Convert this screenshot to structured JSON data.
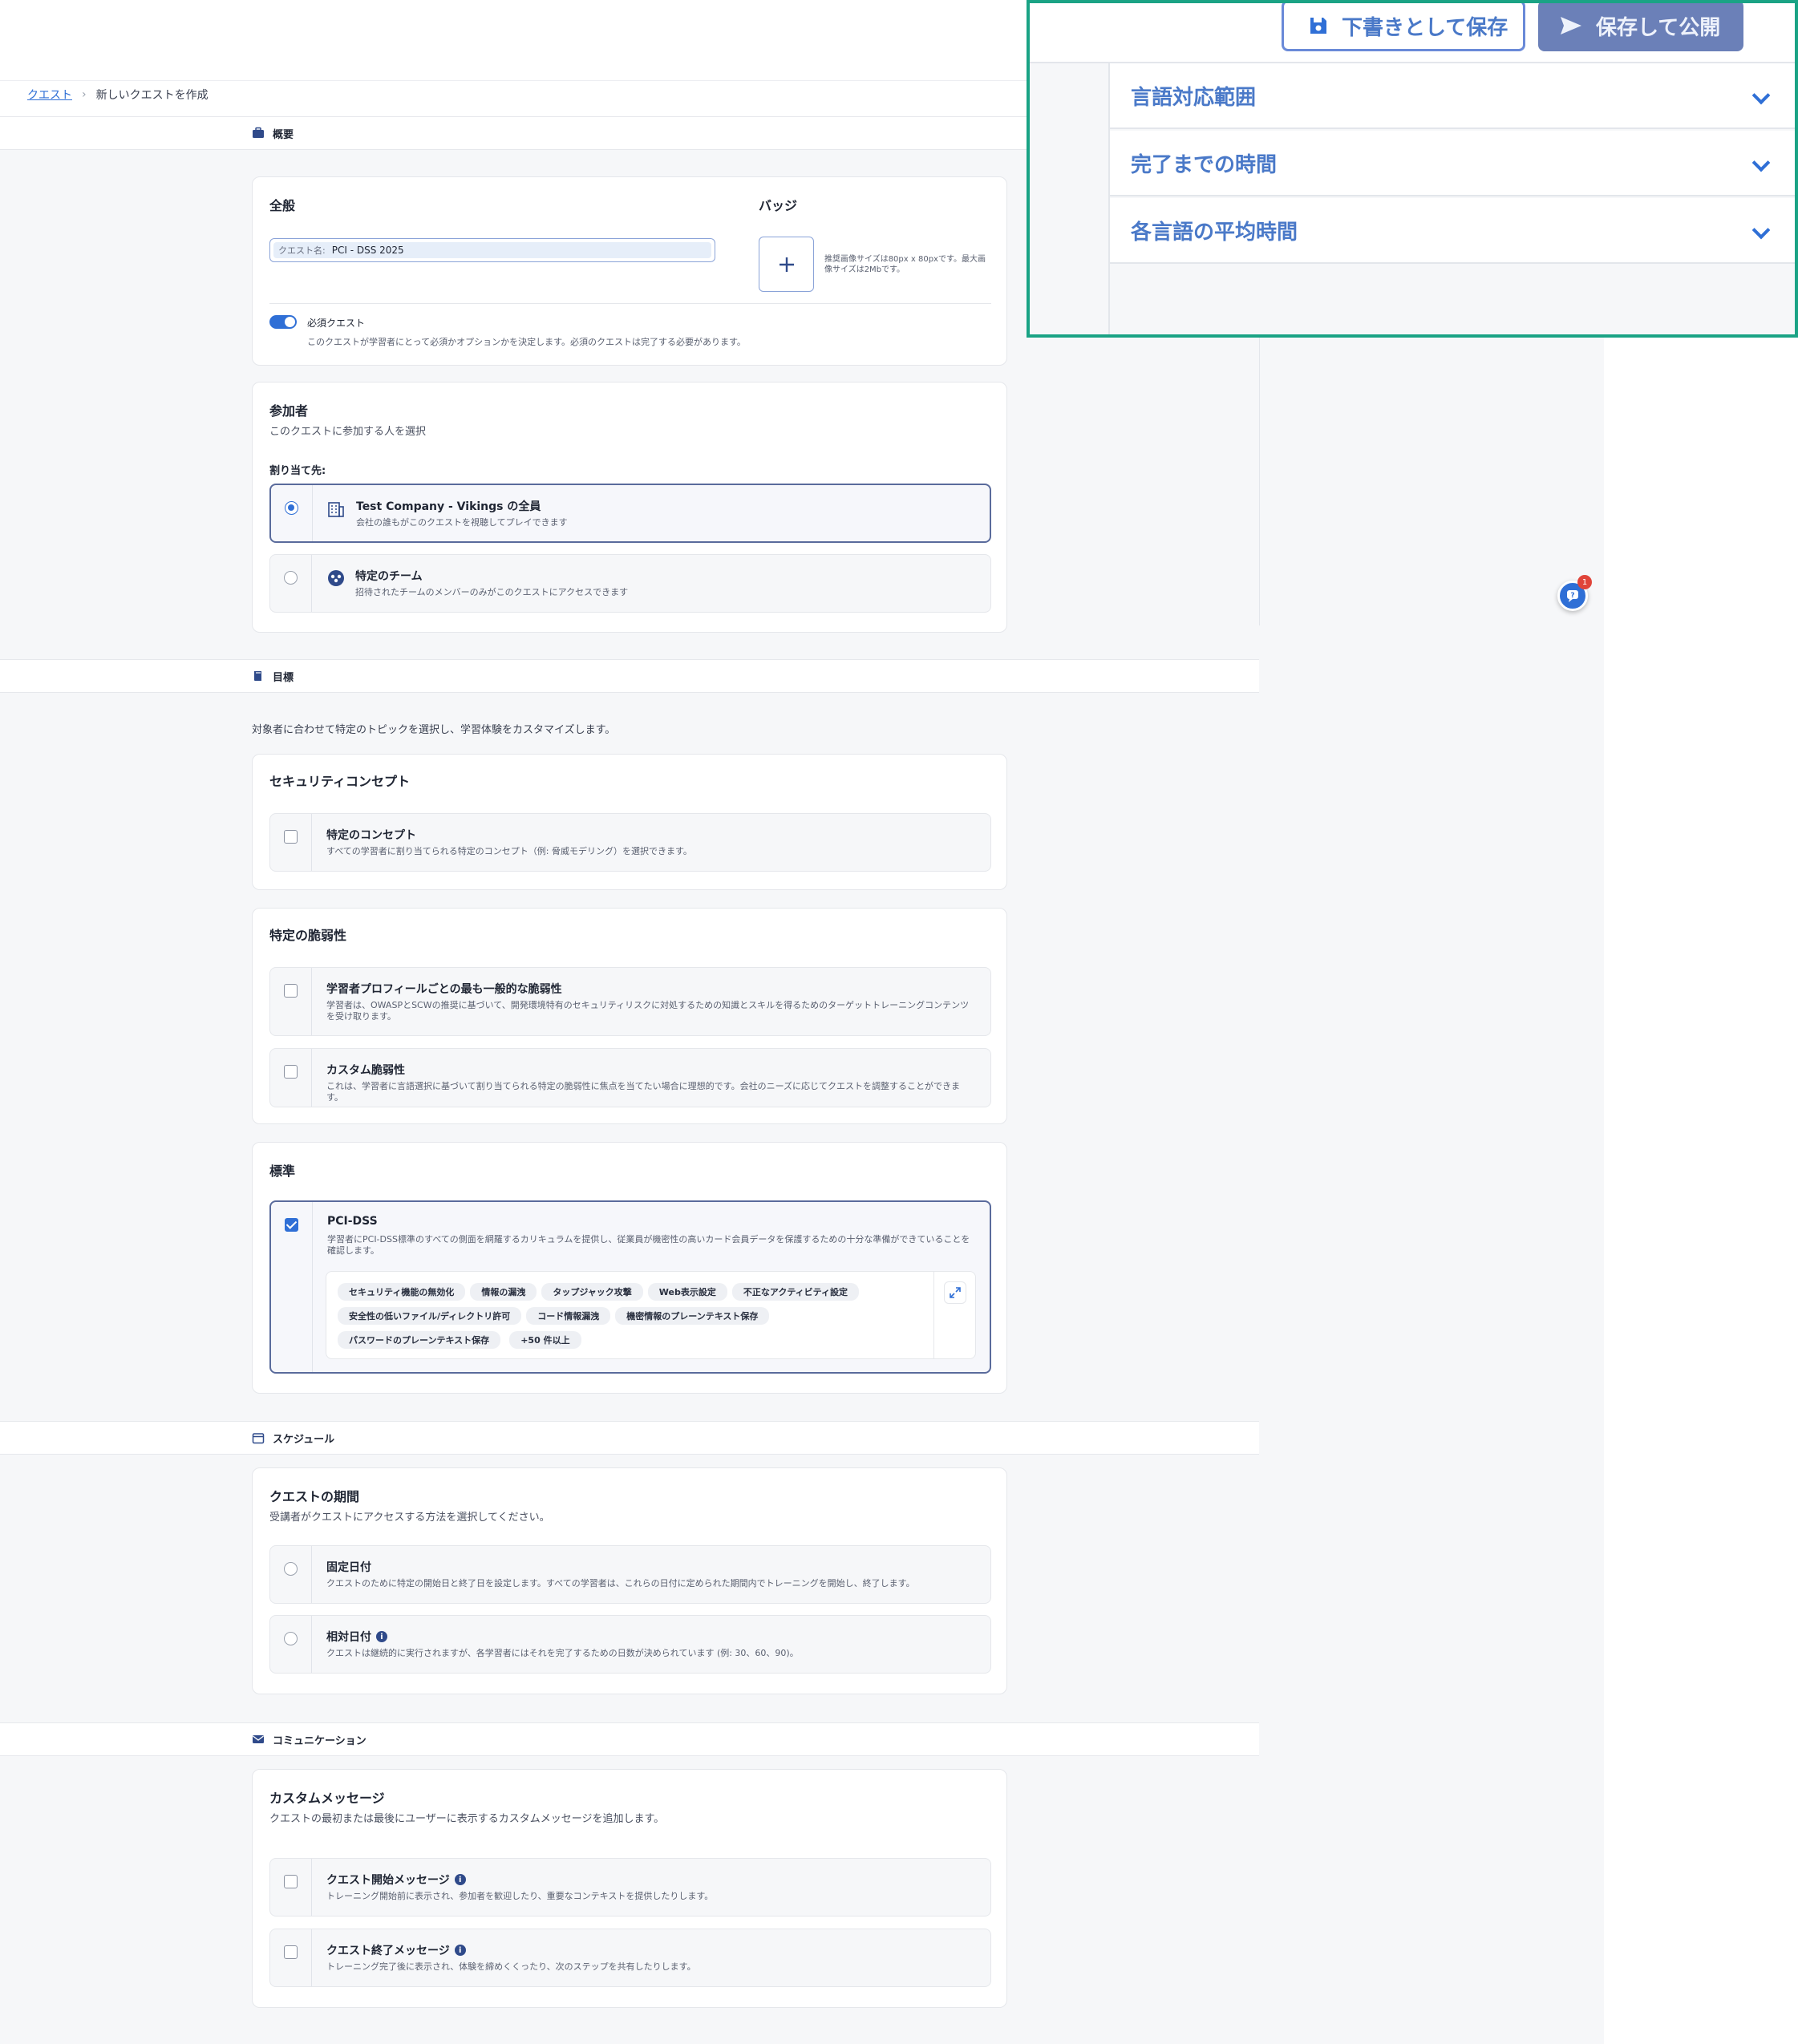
{
  "breadcrumb": {
    "root": "クエスト",
    "current": "新しいクエストを作成"
  },
  "sections": {
    "overview": "概要",
    "objectives": "目標",
    "schedule": "スケジュール",
    "communication": "コミュニケーション"
  },
  "general": {
    "title": "全般",
    "quest_name_label": "クエスト名:",
    "quest_name_value": "PCI - DSS 2025",
    "badge_title": "バッジ",
    "badge_hint": "推奨画像サイズは80px x 80pxです。最大画像サイズは2Mbです。",
    "required_label": "必須クエスト",
    "required_desc": "このクエストが学習者にとって必須かオプションかを決定します。必須のクエストは完了する必要があります。"
  },
  "participants": {
    "title": "参加者",
    "subtitle": "このクエストに参加する人を選択",
    "assign_label": "割り当て先:",
    "options": [
      {
        "title": "Test Company - Vikings の全員",
        "desc": "会社の誰もがこのクエストを視聴してプレイできます"
      },
      {
        "title": "特定のチーム",
        "desc": "招待されたチームのメンバーのみがこのクエストにアクセスできます"
      }
    ]
  },
  "objectives": {
    "intro": "対象者に合わせて特定のトピックを選択し、学習体験をカスタマイズします。",
    "security_concepts": {
      "title": "セキュリティコンセプト",
      "option_title": "特定のコンセプト",
      "option_desc": "すべての学習者に割り当てられる特定のコンセプト（例: 脅威モデリング）を選択できます。"
    },
    "vulnerabilities": {
      "title": "特定の脆弱性",
      "options": [
        {
          "title": "学習者プロフィールごとの最も一般的な脆弱性",
          "desc": "学習者は、OWASPとSCWの推奨に基づいて、開発環境特有のセキュリティリスクに対処するための知識とスキルを得るためのターゲットトレーニングコンテンツを受け取ります。"
        },
        {
          "title": "カスタム脆弱性",
          "desc": "これは、学習者に言語選択に基づいて割り当てられる特定の脆弱性に焦点を当てたい場合に理想的です。会社のニーズに応じてクエストを調整することができます。"
        }
      ]
    },
    "standards": {
      "title": "標準",
      "option_title": "PCI-DSS",
      "option_desc": "学習者にPCI-DSS標準のすべての側面を網羅するカリキュラムを提供し、従業員が機密性の高いカード会員データを保護するための十分な準備ができていることを確認します。",
      "tags": [
        "セキュリティ機能の無効化",
        "情報の漏洩",
        "タップジャック攻撃",
        "Web表示設定",
        "不正なアクティビティ設定",
        "安全性の低いファイル/ディレクトリ許可",
        "コード情報漏洩",
        "機密情報のプレーンテキスト保存",
        "パスワードのプレーンテキスト保存",
        "+50 件以上"
      ]
    }
  },
  "schedule": {
    "title": "クエストの期間",
    "subtitle": "受講者がクエストにアクセスする方法を選択してください。",
    "options": [
      {
        "title": "固定日付",
        "desc": "クエストのために特定の開始日と終了日を設定します。すべての学習者は、これらの日付に定められた期間内でトレーニングを開始し、終了します。"
      },
      {
        "title": "相対日付",
        "desc": "クエストは継続的に実行されますが、各学習者にはそれを完了するための日数が決められています (例: 30、60、90)。"
      }
    ]
  },
  "communication": {
    "title": "カスタムメッセージ",
    "subtitle": "クエストの最初または最後にユーザーに表示するカスタムメッセージを追加します。",
    "options": [
      {
        "title": "クエスト開始メッセージ",
        "desc": "トレーニング開始前に表示され、参加者を歓迎したり、重要なコンテキストを提供したりします。"
      },
      {
        "title": "クエスト終了メッセージ",
        "desc": "トレーニング完了後に表示され、体験を締めくくったり、次のステップを共有したりします。"
      }
    ]
  },
  "overlay": {
    "save_draft": "下書きとして保存",
    "save_publish": "保存して公開",
    "accordion": [
      "言語対応範囲",
      "完了までの時間",
      "各言語の平均時間"
    ]
  },
  "help": {
    "badge_count": "1"
  },
  "colors": {
    "accent": "#2f6fd6",
    "overlay_border": "#1aa385",
    "publish_button": "#6b80b8"
  }
}
